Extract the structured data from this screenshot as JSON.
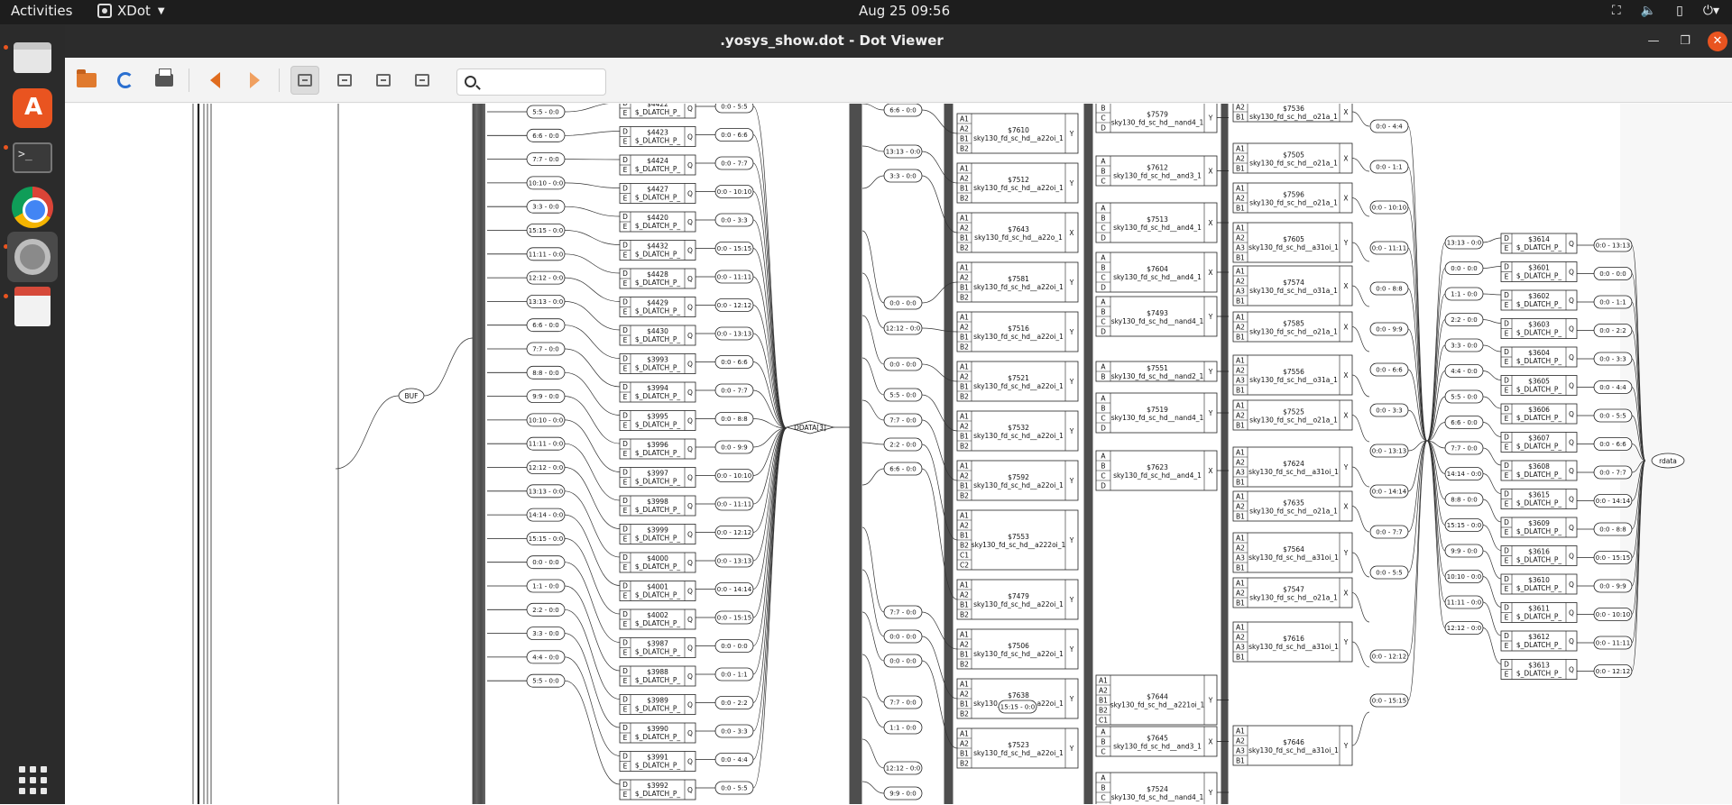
{
  "topbar": {
    "activities": "Activities",
    "app_name": "XDot",
    "clock": "Aug 25  09:56"
  },
  "dock": {
    "items": [
      {
        "name": "Files",
        "icon": "files-icon"
      },
      {
        "name": "Ubuntu Software",
        "icon": "software-store-icon"
      },
      {
        "name": "Terminal",
        "icon": "terminal-icon"
      },
      {
        "name": "Google Chrome",
        "icon": "chrome-icon"
      },
      {
        "name": "Settings",
        "icon": "settings-icon"
      },
      {
        "name": "Document Viewer",
        "icon": "document-viewer-icon"
      },
      {
        "name": "Show Applications",
        "icon": "app-grid-icon"
      }
    ],
    "terminal_glyph": ">_"
  },
  "window": {
    "title": ".yosys_show.dot - Dot Viewer"
  },
  "toolbar": {
    "search_value": "",
    "icons": [
      "open-icon",
      "reload-icon",
      "print-icon",
      "back-icon",
      "forward-icon",
      "zoom-in-icon",
      "zoom-out-icon",
      "zoom-fit-icon",
      "zoom-100-icon"
    ]
  },
  "graph": {
    "buf_label": "BUF",
    "ddata_label": "DDATA[3]",
    "rdata_label": "rdata",
    "col_a_slices": [
      "5:5 - 0:0",
      "6:6 - 0:0",
      "7:7 - 0:0",
      "10:10 - 0:0",
      "3:3 - 0:0",
      "15:15 - 0:0",
      "11:11 - 0:0",
      "12:12 - 0:0",
      "13:13 - 0:0",
      "6:6 - 0:0",
      "7:7 - 0:0",
      "8:8 - 0:0",
      "9:9 - 0:0",
      "10:10 - 0:0",
      "11:11 - 0:0",
      "12:12 - 0:0",
      "13:13 - 0:0",
      "14:14 - 0:0",
      "15:15 - 0:0",
      "0:0 - 0:0",
      "1:1 - 0:0",
      "2:2 - 0:0",
      "3:3 - 0:0",
      "4:4 - 0:0",
      "5:5 - 0:0"
    ],
    "latches_a": [
      {
        "id": "$4422",
        "type": "$_DLATCH_P_"
      },
      {
        "id": "$4423",
        "type": "$_DLATCH_P_"
      },
      {
        "id": "$4424",
        "type": "$_DLATCH_P_"
      },
      {
        "id": "$4427",
        "type": "$_DLATCH_P_"
      },
      {
        "id": "$4420",
        "type": "$_DLATCH_P_"
      },
      {
        "id": "$4432",
        "type": "$_DLATCH_P_"
      },
      {
        "id": "$4428",
        "type": "$_DLATCH_P_"
      },
      {
        "id": "$4429",
        "type": "$_DLATCH_P_"
      },
      {
        "id": "$4430",
        "type": "$_DLATCH_P_"
      },
      {
        "id": "$3993",
        "type": "$_DLATCH_P_"
      },
      {
        "id": "$3994",
        "type": "$_DLATCH_P_"
      },
      {
        "id": "$3995",
        "type": "$_DLATCH_P_"
      },
      {
        "id": "$3996",
        "type": "$_DLATCH_P_"
      },
      {
        "id": "$3997",
        "type": "$_DLATCH_P_"
      },
      {
        "id": "$3998",
        "type": "$_DLATCH_P_"
      },
      {
        "id": "$3999",
        "type": "$_DLATCH_P_"
      },
      {
        "id": "$4000",
        "type": "$_DLATCH_P_"
      },
      {
        "id": "$4001",
        "type": "$_DLATCH_P_"
      },
      {
        "id": "$4002",
        "type": "$_DLATCH_P_"
      },
      {
        "id": "$3987",
        "type": "$_DLATCH_P_"
      },
      {
        "id": "$3988",
        "type": "$_DLATCH_P_"
      },
      {
        "id": "$3989",
        "type": "$_DLATCH_P_"
      },
      {
        "id": "$3990",
        "type": "$_DLATCH_P_"
      },
      {
        "id": "$3991",
        "type": "$_DLATCH_P_"
      },
      {
        "id": "$3992",
        "type": "$_DLATCH_P_"
      }
    ],
    "col_b_slices": [
      "0:0 - 5:5",
      "0:0 - 6:6",
      "0:0 - 7:7",
      "0:0 - 10:10",
      "0:0 - 3:3",
      "0:0 - 15:15",
      "0:0 - 11:11",
      "0:0 - 12:12",
      "0:0 - 13:13",
      "0:0 - 6:6",
      "0:0 - 7:7",
      "0:0 - 8:8",
      "0:0 - 9:9",
      "0:0 - 10:10",
      "0:0 - 11:11",
      "0:0 - 12:12",
      "0:0 - 13:13",
      "0:0 - 14:14",
      "0:0 - 15:15",
      "0:0 - 0:0",
      "0:0 - 1:1",
      "0:0 - 2:2",
      "0:0 - 3:3",
      "0:0 - 4:4",
      "0:0 - 5:5"
    ],
    "col_c_slices": [
      "6:6 - 0:0",
      "13:13 - 0:0",
      "3:3 - 0:0",
      "0:0 - 0:0",
      "12:12 - 0:0",
      "0:0 - 0:0",
      "5:5 - 0:0",
      "7:7 - 0:0",
      "2:2 - 0:0",
      "6:6 - 0:0",
      "7:7 - 0:0",
      "0:0 - 0:0",
      "0:0 - 0:0",
      "7:7 - 0:0",
      "1:1 - 0:0",
      "12:12 - 0:0",
      "9:9 - 0:0"
    ],
    "cells_a": [
      {
        "id": "$7610",
        "type": "sky130_fd_sc_hd__a22oi_1",
        "pins": [
          "A1",
          "A2",
          "B1",
          "B2"
        ],
        "out": "Y"
      },
      {
        "id": "$7512",
        "type": "sky130_fd_sc_hd__a22oi_1",
        "pins": [
          "A1",
          "A2",
          "B1",
          "B2"
        ],
        "out": "Y"
      },
      {
        "id": "$7643",
        "type": "sky130_fd_sc_hd__a22o_1",
        "pins": [
          "A1",
          "A2",
          "B1",
          "B2"
        ],
        "out": "X"
      },
      {
        "id": "$7581",
        "type": "sky130_fd_sc_hd__a22oi_1",
        "pins": [
          "A1",
          "A2",
          "B1",
          "B2"
        ],
        "out": "Y"
      },
      {
        "id": "$7516",
        "type": "sky130_fd_sc_hd__a22oi_1",
        "pins": [
          "A1",
          "A2",
          "B1",
          "B2"
        ],
        "out": "Y"
      },
      {
        "id": "$7521",
        "type": "sky130_fd_sc_hd__a22oi_1",
        "pins": [
          "A1",
          "A2",
          "B1",
          "B2"
        ],
        "out": "Y"
      },
      {
        "id": "$7532",
        "type": "sky130_fd_sc_hd__a22oi_1",
        "pins": [
          "A1",
          "A2",
          "B1",
          "B2"
        ],
        "out": "Y"
      },
      {
        "id": "$7592",
        "type": "sky130_fd_sc_hd__a22oi_1",
        "pins": [
          "A1",
          "A2",
          "B1",
          "B2"
        ],
        "out": "Y"
      },
      {
        "id": "$7553",
        "type": "sky130_fd_sc_hd__a222oi_1",
        "pins": [
          "A1",
          "A2",
          "B1",
          "B2",
          "C1",
          "C2"
        ],
        "out": "Y"
      },
      {
        "id": "$7479",
        "type": "sky130_fd_sc_hd__a22oi_1",
        "pins": [
          "A1",
          "A2",
          "B1",
          "B2"
        ],
        "out": "Y"
      },
      {
        "id": "$7506",
        "type": "sky130_fd_sc_hd__a22oi_1",
        "pins": [
          "A1",
          "A2",
          "B1",
          "B2"
        ],
        "out": "Y"
      },
      {
        "id": "$7638",
        "type": "sky130_fd_sc_hd__a22oi_1",
        "pins": [
          "A1",
          "A2",
          "B1",
          "B2"
        ],
        "out": "Y"
      },
      {
        "id": "$7523",
        "type": "sky130_fd_sc_hd__a22oi_1",
        "pins": [
          "A1",
          "A2",
          "B1",
          "B2"
        ],
        "out": "Y"
      }
    ],
    "slice_15": "15:15 - 0:0",
    "cells_b": [
      {
        "id": "$7579",
        "type": "sky130_fd_sc_hd__nand4_1",
        "pins": [
          "B",
          "C",
          "D"
        ],
        "out": "Y"
      },
      {
        "id": "$7612",
        "type": "sky130_fd_sc_hd__and3_1",
        "pins": [
          "A",
          "B",
          "C"
        ],
        "out": "X"
      },
      {
        "id": "$7513",
        "type": "sky130_fd_sc_hd__and4_1",
        "pins": [
          "A",
          "B",
          "C",
          "D"
        ],
        "out": "X"
      },
      {
        "id": "$7604",
        "type": "sky130_fd_sc_hd__and4_1",
        "pins": [
          "A",
          "B",
          "C",
          "D"
        ],
        "out": "X"
      },
      {
        "id": "$7493",
        "type": "sky130_fd_sc_hd__nand4_1",
        "pins": [
          "A",
          "B",
          "C",
          "D"
        ],
        "out": "Y"
      },
      {
        "id": "$7551",
        "type": "sky130_fd_sc_hd__nand2_1",
        "pins": [
          "A",
          "B"
        ],
        "out": "Y"
      },
      {
        "id": "$7519",
        "type": "sky130_fd_sc_hd__nand4_1",
        "pins": [
          "A",
          "B",
          "C",
          "D"
        ],
        "out": "Y"
      },
      {
        "id": "$7623",
        "type": "sky130_fd_sc_hd__and4_1",
        "pins": [
          "A",
          "B",
          "C",
          "D"
        ],
        "out": "X"
      },
      {
        "id": "$7644",
        "type": "sky130_fd_sc_hd__a221oi_1",
        "pins": [
          "A1",
          "A2",
          "B1",
          "B2",
          "C1"
        ],
        "out": "Y"
      },
      {
        "id": "$7645",
        "type": "sky130_fd_sc_hd__and3_1",
        "pins": [
          "A",
          "B",
          "C"
        ],
        "out": "X"
      },
      {
        "id": "$7524",
        "type": "sky130_fd_sc_hd__nand4_1",
        "pins": [
          "A",
          "B",
          "C",
          "D"
        ],
        "out": "Y"
      }
    ],
    "cells_c": [
      {
        "id": "$7536",
        "type": "sky130_fd_sc_hd__o21a_1",
        "pins": [
          "A2",
          "B1"
        ],
        "out": "X"
      },
      {
        "id": "$7505",
        "type": "sky130_fd_sc_hd__o21a_1",
        "pins": [
          "A1",
          "A2",
          "B1"
        ],
        "out": "X"
      },
      {
        "id": "$7596",
        "type": "sky130_fd_sc_hd__o21a_1",
        "pins": [
          "A1",
          "A2",
          "B1"
        ],
        "out": "X"
      },
      {
        "id": "$7605",
        "type": "sky130_fd_sc_hd__a31oi_1",
        "pins": [
          "A1",
          "A2",
          "A3",
          "B1"
        ],
        "out": "Y"
      },
      {
        "id": "$7574",
        "type": "sky130_fd_sc_hd__o31a_1",
        "pins": [
          "A1",
          "A2",
          "A3",
          "B1"
        ],
        "out": "X"
      },
      {
        "id": "$7585",
        "type": "sky130_fd_sc_hd__o21a_1",
        "pins": [
          "A1",
          "A2",
          "B1"
        ],
        "out": "X"
      },
      {
        "id": "$7556",
        "type": "sky130_fd_sc_hd__o31a_1",
        "pins": [
          "A1",
          "A2",
          "A3",
          "B1"
        ],
        "out": "X"
      },
      {
        "id": "$7525",
        "type": "sky130_fd_sc_hd__o21a_1",
        "pins": [
          "A1",
          "A2",
          "B1"
        ],
        "out": "X"
      },
      {
        "id": "$7624",
        "type": "sky130_fd_sc_hd__a31oi_1",
        "pins": [
          "A1",
          "A2",
          "A3",
          "B1"
        ],
        "out": "Y"
      },
      {
        "id": "$7635",
        "type": "sky130_fd_sc_hd__o21a_1",
        "pins": [
          "A1",
          "A2",
          "B1"
        ],
        "out": "X"
      },
      {
        "id": "$7564",
        "type": "sky130_fd_sc_hd__a31oi_1",
        "pins": [
          "A1",
          "A2",
          "A3",
          "B1"
        ],
        "out": "Y"
      },
      {
        "id": "$7547",
        "type": "sky130_fd_sc_hd__o21a_1",
        "pins": [
          "A1",
          "A2",
          "B1"
        ],
        "out": "X"
      },
      {
        "id": "$7616",
        "type": "sky130_fd_sc_hd__a31oi_1",
        "pins": [
          "A1",
          "A2",
          "A3",
          "B1"
        ],
        "out": "Y"
      },
      {
        "id": "$7646",
        "type": "sky130_fd_sc_hd__a31oi_1",
        "pins": [
          "A1",
          "A2",
          "A3",
          "B1"
        ],
        "out": "Y"
      }
    ],
    "col_d_slices": [
      "0:0 - 4:4",
      "0:0 - 1:1",
      "0:0 - 10:10",
      "0:0 - 11:11",
      "0:0 - 8:8",
      "0:0 - 9:9",
      "0:0 - 6:6",
      "0:0 - 3:3",
      "0:0 - 13:13",
      "0:0 - 14:14",
      "0:0 - 7:7",
      "0:0 - 5:5",
      "0:0 - 12:12",
      "0:0 - 15:15"
    ],
    "col_e_slices": [
      "13:13 - 0:0",
      "0:0 - 0:0",
      "1:1 - 0:0",
      "2:2 - 0:0",
      "3:3 - 0:0",
      "4:4 - 0:0",
      "5:5 - 0:0",
      "6:6 - 0:0",
      "7:7 - 0:0",
      "14:14 - 0:0",
      "8:8 - 0:0",
      "15:15 - 0:0",
      "9:9 - 0:0",
      "10:10 - 0:0",
      "11:11 - 0:0",
      "12:12 - 0:0"
    ],
    "latches_b": [
      {
        "id": "$3614",
        "type": "$_DLATCH_P_"
      },
      {
        "id": "$3601",
        "type": "$_DLATCH_P_"
      },
      {
        "id": "$3602",
        "type": "$_DLATCH_P_"
      },
      {
        "id": "$3603",
        "type": "$_DLATCH_P_"
      },
      {
        "id": "$3604",
        "type": "$_DLATCH_P_"
      },
      {
        "id": "$3605",
        "type": "$_DLATCH_P_"
      },
      {
        "id": "$3606",
        "type": "$_DLATCH_P_"
      },
      {
        "id": "$3607",
        "type": "$_DLATCH_P_"
      },
      {
        "id": "$3608",
        "type": "$_DLATCH_P_"
      },
      {
        "id": "$3615",
        "type": "$_DLATCH_P_"
      },
      {
        "id": "$3609",
        "type": "$_DLATCH_P_"
      },
      {
        "id": "$3616",
        "type": "$_DLATCH_P_"
      },
      {
        "id": "$3610",
        "type": "$_DLATCH_P_"
      },
      {
        "id": "$3611",
        "type": "$_DLATCH_P_"
      },
      {
        "id": "$3612",
        "type": "$_DLATCH_P_"
      },
      {
        "id": "$3613",
        "type": "$_DLATCH_P_"
      }
    ],
    "col_f_slices": [
      "0:0 - 13:13",
      "0:0 - 0:0",
      "0:0 - 1:1",
      "0:0 - 2:2",
      "0:0 - 3:3",
      "0:0 - 4:4",
      "0:0 - 5:5",
      "0:0 - 6:6",
      "0:0 - 7:7",
      "0:0 - 14:14",
      "0:0 - 8:8",
      "0:0 - 15:15",
      "0:0 - 9:9",
      "0:0 - 10:10",
      "0:0 - 11:11",
      "0:0 - 12:12"
    ]
  }
}
